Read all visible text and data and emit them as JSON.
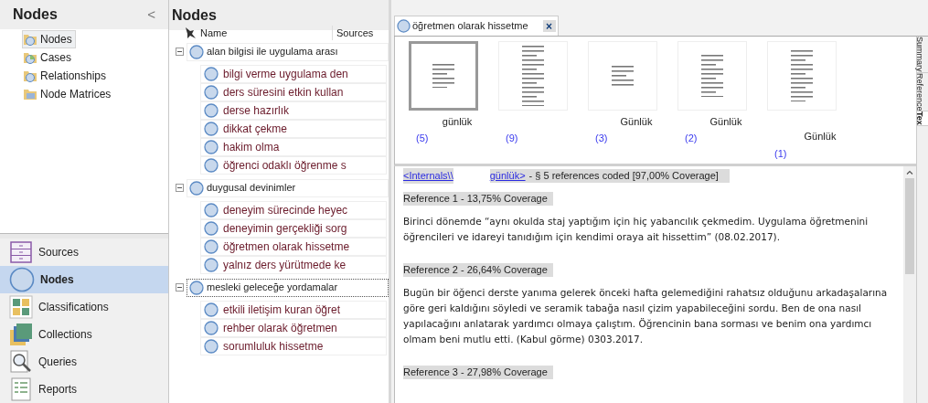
{
  "navigation": {
    "title": "Nodes",
    "collapse_glyph": "<",
    "tree": [
      {
        "label": "Nodes",
        "selected": true
      },
      {
        "label": "Cases",
        "selected": false
      },
      {
        "label": "Relationships",
        "selected": false
      },
      {
        "label": "Node Matrices",
        "selected": false
      }
    ],
    "sections": [
      {
        "label": "Sources",
        "selected": false
      },
      {
        "label": "Nodes",
        "selected": true
      },
      {
        "label": "Classifications",
        "selected": false
      },
      {
        "label": "Collections",
        "selected": false
      },
      {
        "label": "Queries",
        "selected": false
      },
      {
        "label": "Reports",
        "selected": false
      }
    ]
  },
  "node_list": {
    "title": "Nodes",
    "columns": [
      "Name",
      "Sources"
    ],
    "nodes": [
      {
        "name": "alan bilgisi ile uygulama arası",
        "expanded": true,
        "focused": false,
        "children": [
          {
            "name": "bilgi verme uygulama den"
          },
          {
            "name": "ders süresini etkin kullan"
          },
          {
            "name": "derse hazırlık"
          },
          {
            "name": "dikkat çekme"
          },
          {
            "name": "hakim olma"
          },
          {
            "name": "öğrenci odaklı öğrenme s"
          }
        ]
      },
      {
        "name": "duygusal devinimler",
        "expanded": true,
        "focused": false,
        "children": [
          {
            "name": "deneyim sürecinde heyec"
          },
          {
            "name": "deneyimin gerçekliği sorg"
          },
          {
            "name": "öğretmen olarak hissetme"
          },
          {
            "name": "yalnız ders yürütmede ke"
          }
        ]
      },
      {
        "name": "mesleki geleceğe yordamalar",
        "expanded": true,
        "focused": true,
        "children": [
          {
            "name": "etkili iletişim kuran öğret"
          },
          {
            "name": "rehber olarak öğretmen"
          },
          {
            "name": "sorumluluk hissetme"
          }
        ]
      }
    ]
  },
  "document_tab": {
    "title": "öğretmen olarak hissetme",
    "close_glyph": "×"
  },
  "thumbnails": [
    {
      "caption": "günlük",
      "count": "(5)",
      "selected": true
    },
    {
      "count": "(9)",
      "selected": false
    },
    {
      "caption": "Günlük",
      "count": "(3)",
      "selected": false
    },
    {
      "caption": "Günlük",
      "count": "(2)",
      "selected": false
    },
    {
      "caption": "Günlük",
      "count": "(1)",
      "selected": false
    }
  ],
  "side_tabs": [
    {
      "label": "Summary",
      "selected": false
    },
    {
      "label": "Reference",
      "selected": false
    },
    {
      "label": "Tex",
      "selected": true
    }
  ],
  "text_view": {
    "link_start": "<Internals\\\\",
    "link_end": "günlük>",
    "summary": "- § 5 references coded  [97,00% Coverage]",
    "references": [
      {
        "heading": "Reference 1 - 13,75% Coverage",
        "text": "Birinci dönemde “aynı okulda staj yaptığım için hiç yabancılık çekmedim. Uygulama öğretmenini öğrencileri ve idareyi tanıdığım için kendimi oraya ait hissettim” (08.02.2017)."
      },
      {
        "heading": "Reference 2 - 26,64% Coverage",
        "text": "Bugün bir öğenci derste yanıma gelerek önceki hafta gelemediğini rahatsız olduğunu arkadaşalarına göre geri kaldığını söyledi ve seramik tabağa nasıl çizim yapabileceğini sordu. Ben de ona nasıl yapılacağını anlatarak yardımcı olmaya çalıştım. Öğrencinin bana sorması ve benim ona yardımcı olmam beni mutlu etti. (Kabul görme) 0303.2017."
      },
      {
        "heading": "Reference 3 - 27,98% Coverage"
      }
    ]
  }
}
